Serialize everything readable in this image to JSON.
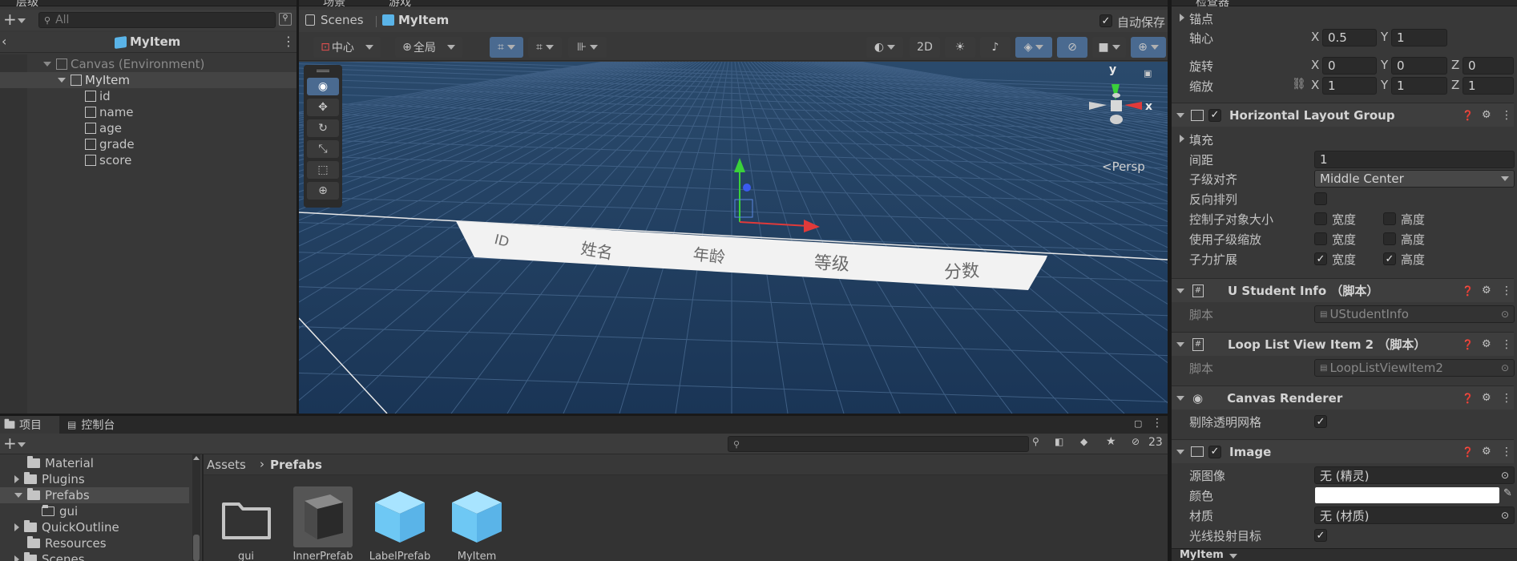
{
  "hierarchy": {
    "tab_label": "层级",
    "search_placeholder": "All",
    "scene_title": "MyItem",
    "items": [
      {
        "label": "Canvas (Environment)"
      },
      {
        "label": "MyItem"
      },
      {
        "label": "id"
      },
      {
        "label": "name"
      },
      {
        "label": "age"
      },
      {
        "label": "grade"
      },
      {
        "label": "score"
      }
    ]
  },
  "scene": {
    "tabs": [
      {
        "label": "场景"
      },
      {
        "label": "游戏"
      }
    ],
    "breadcrumb": {
      "root": "Scenes",
      "current": "MyItem"
    },
    "autosave_label": "自动保存",
    "pivot_mode": "中心",
    "space_mode": "全局",
    "mode_2d": "2D",
    "persp_label": "<Persp",
    "gizmo_axes": {
      "y": "y",
      "x": "x"
    },
    "columns": [
      "ID",
      "姓名",
      "年龄",
      "等级",
      "分数"
    ]
  },
  "project": {
    "tabs": [
      {
        "label": "项目"
      },
      {
        "label": "控制台"
      }
    ],
    "hidden_count": "23",
    "breadcrumb": {
      "root": "Assets",
      "current": "Prefabs"
    },
    "folders": [
      {
        "label": "Material"
      },
      {
        "label": "Plugins"
      },
      {
        "label": "Prefabs"
      },
      {
        "label": "gui"
      },
      {
        "label": "QuickOutline"
      },
      {
        "label": "Resources"
      },
      {
        "label": "Scenes"
      }
    ],
    "assets": [
      {
        "label": "gui"
      },
      {
        "label": "InnerPrefab"
      },
      {
        "label": "LabelPrefab"
      },
      {
        "label": "MyItem"
      }
    ]
  },
  "inspector": {
    "tab_label": "检查器",
    "anchor_label": "锚点",
    "pivot": {
      "label": "轴心",
      "x": "0.5",
      "y": "1"
    },
    "rotation": {
      "label": "旋转",
      "x": "0",
      "y": "0",
      "z": "0"
    },
    "scale": {
      "label": "缩放",
      "x": "1",
      "y": "1",
      "z": "1"
    },
    "axis": {
      "x": "X",
      "y": "Y",
      "z": "Z"
    },
    "hlg": {
      "title": "Horizontal Layout Group",
      "padding": "填充",
      "spacing_label": "间距",
      "spacing_value": "1",
      "child_align_label": "子级对齐",
      "child_align_value": "Middle Center",
      "reverse_label": "反向排列",
      "control_size_label": "控制子对象大小",
      "use_scale_label": "使用子级缩放",
      "force_expand_label": "子力扩展",
      "width": "宽度",
      "height": "高度"
    },
    "student_info": {
      "title": "U Student Info （脚本）",
      "script_label": "脚本",
      "script_value": "UStudentInfo"
    },
    "loop_list": {
      "title": "Loop List View Item 2 （脚本）",
      "script_label": "脚本",
      "script_value": "LoopListViewItem2"
    },
    "canvas_renderer": {
      "title": "Canvas Renderer",
      "cull_label": "剔除透明网格"
    },
    "image": {
      "title": "Image",
      "source_label": "源图像",
      "source_value": "无 (精灵)",
      "color_label": "颜色",
      "color_value": "#ffffff",
      "material_label": "材质",
      "material_value": "无 (材质)",
      "raycast_label": "光线投射目标"
    },
    "footer_label": "MyItem"
  },
  "colors": {
    "scene_bg": "#1f3b5c",
    "grid": "#3a5a7e",
    "accent": "#4a90e2",
    "gizmo_green": "#3ad13a",
    "gizmo_red": "#e03a3a"
  }
}
